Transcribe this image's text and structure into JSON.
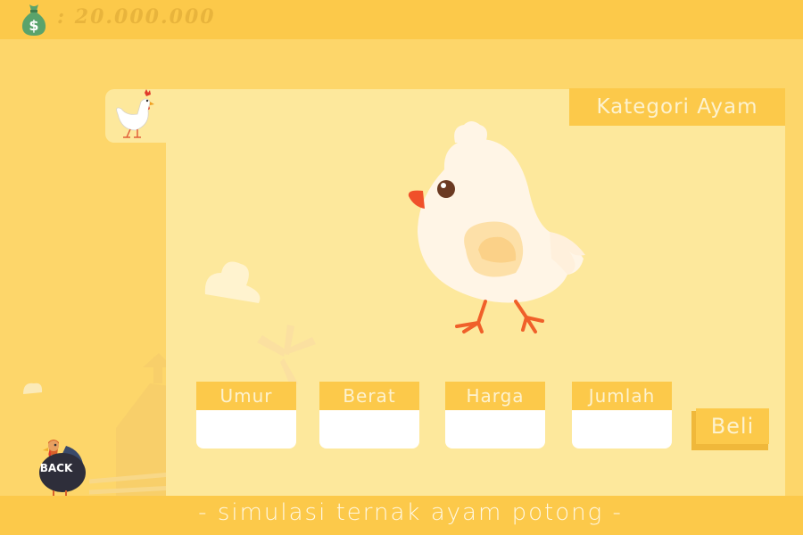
{
  "header": {
    "money_icon": "money-bag-icon",
    "money_text": ": 20.000.000"
  },
  "panel": {
    "category_label": "Kategori Ayam",
    "tab_icon": "chicken-icon",
    "main_image": "chick-illustration"
  },
  "fields": [
    {
      "label": "Umur",
      "value": ""
    },
    {
      "label": "Berat",
      "value": ""
    },
    {
      "label": "Harga",
      "value": ""
    },
    {
      "label": "Jumlah",
      "value": ""
    }
  ],
  "buy_button": {
    "label": "Beli"
  },
  "back_button": {
    "label": "BACK",
    "icon": "turkey-icon"
  },
  "footer": {
    "text": "- simulasi ternak ayam potong -"
  },
  "colors": {
    "background": "#fdd66a",
    "bar": "#fcc94a",
    "panel": "#fde89c",
    "label_text": "#fdf2cf",
    "money_text": "#e8b43c"
  }
}
